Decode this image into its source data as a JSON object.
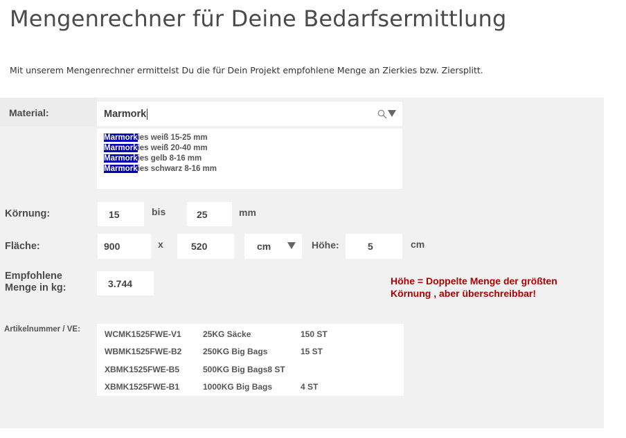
{
  "header": {
    "title": "Mengenrechner für Deine Bedarfsermittlung",
    "intro": "Mit unserem Mengenrechner ermittelst Du die für Dein Projekt empfohlene Menge an Zierkies bzw. Ziersplitt."
  },
  "material": {
    "label": "Material:",
    "value": "Marmork",
    "suggestions": [
      {
        "match": "Marmork",
        "rest": "ies weiß 15-25 mm"
      },
      {
        "match": "Marmork",
        "rest": "ies weiß 20-40 mm"
      },
      {
        "match": "Marmork",
        "rest": "ies gelb 8-16 mm"
      },
      {
        "match": "Marmork",
        "rest": "ies schwarz 8-16 mm"
      }
    ]
  },
  "koernung": {
    "label": "Körnung:",
    "from": "15",
    "sep": "bis",
    "to": "25",
    "unit": "mm"
  },
  "flaeche": {
    "label": "Fläche:",
    "width": "900",
    "sep": "x",
    "length": "520",
    "unit": "cm",
    "hoehe_label": "Höhe:",
    "hoehe": "5",
    "hoehe_unit": "cm"
  },
  "empfohlen": {
    "label_line1": "Empfohlene",
    "label_line2": "Menge in kg:",
    "value": "3.744"
  },
  "note": {
    "line1": "Höhe = Doppelte Menge der größten",
    "line2": "Körnung , aber überschreibbar!",
    "color": "#b00000"
  },
  "articles": {
    "label": "Artikelnummer / VE:",
    "rows": [
      {
        "nr": "WCMK1525FWE-V1",
        "pack": "25KG Säcke",
        "qty": "150 ST"
      },
      {
        "nr": "WBMK1525FWE-B2",
        "pack": "250KG Big Bags",
        "qty": "15 ST"
      },
      {
        "nr": "XBMK1525FWE-B5",
        "pack": "500KG Big Bags",
        "qty": "8 ST"
      },
      {
        "nr": "XBMK1525FWE-B1",
        "pack": "1000KG Big Bags",
        "qty": "4 ST"
      }
    ]
  },
  "icons": {
    "search": "search-icon",
    "dropdown": "triangle-down-icon"
  },
  "colors": {
    "highlight": "#0000b4",
    "panel": "#f1f1f1",
    "note": "#b00000"
  }
}
